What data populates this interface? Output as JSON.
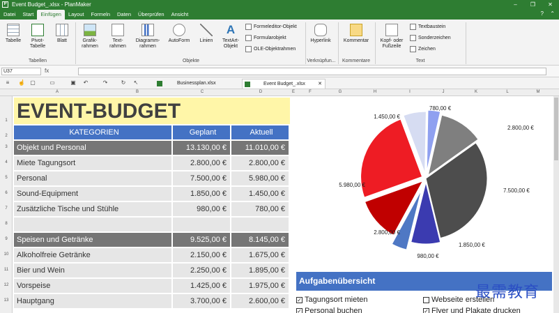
{
  "window": {
    "title": "Event Budget_.xlsx - PlanMaker",
    "app_icon": "P",
    "min": "–",
    "max": "❐",
    "close": "✕"
  },
  "menu": {
    "items": [
      "Datei",
      "Start",
      "Einfügen",
      "Layout",
      "Formeln",
      "Daten",
      "Überprüfen",
      "Ansicht"
    ],
    "active": "Einfügen",
    "help": "?",
    "collapse": "⌃"
  },
  "ribbon": {
    "tabellen": {
      "label": "Tabellen",
      "buttons": [
        "Tabelle",
        "Pivot-Tabelle",
        "Blatt"
      ]
    },
    "objekte": {
      "label": "Objekte",
      "buttons": [
        "Grafik-rahmen",
        "Text-rahmen",
        "Diagramm-rahmen",
        "AutoForm",
        "Linien",
        "TextArt-Objekt"
      ],
      "small": [
        "Formeleditor-Objekt",
        "Formularobjekt",
        "OLE-Objektrahmen"
      ]
    },
    "verknuepfungen": {
      "label": "Verknüpfun...",
      "buttons": [
        "Hyperlink"
      ]
    },
    "kommentare": {
      "label": "Kommentare",
      "buttons": [
        "Kommentar"
      ]
    },
    "text": {
      "label": "Text",
      "buttons": [
        "Kopf- oder Fußzeile"
      ],
      "small": [
        "Textbaustein",
        "Sonderzeichen",
        "Zeichen"
      ]
    }
  },
  "formula": {
    "cell": "U37",
    "fx": "fx",
    "value": ""
  },
  "tabs": {
    "items": [
      "Businessplan.xlsx",
      "Event Budget_.xlsx"
    ],
    "active": "Event Budget_.xlsx",
    "close": "✕"
  },
  "columns": [
    "A",
    "B",
    "C",
    "D",
    "E",
    "F",
    "G",
    "H",
    "I",
    "J",
    "K",
    "L",
    "M"
  ],
  "sheet": {
    "title": "EVENT-BUDGET",
    "headers": {
      "category": "KATEGORIEN",
      "planned": "Geplant",
      "actual": "Aktuell"
    },
    "rows": [
      {
        "n": "3",
        "type": "group",
        "label": "Objekt und Personal",
        "planned": "13.130,00 €",
        "actual": "11.010,00 €"
      },
      {
        "n": "4",
        "type": "item",
        "label": "Miete Tagungsort",
        "planned": "2.800,00 €",
        "actual": "2.800,00 €"
      },
      {
        "n": "5",
        "type": "item",
        "label": "Personal",
        "planned": "7.500,00 €",
        "actual": "5.980,00 €"
      },
      {
        "n": "6",
        "type": "item",
        "label": "Sound-Equipment",
        "planned": "1.850,00 €",
        "actual": "1.450,00 €"
      },
      {
        "n": "7",
        "type": "item",
        "label": "Zusätzliche Tische und Stühle",
        "planned": "980,00 €",
        "actual": "780,00 €"
      },
      {
        "n": "8",
        "type": "empty",
        "label": "",
        "planned": "",
        "actual": ""
      },
      {
        "n": "9",
        "type": "group",
        "label": "Speisen und Getränke",
        "planned": "9.525,00 €",
        "actual": "8.145,00 €"
      },
      {
        "n": "10",
        "type": "item",
        "label": "Alkoholfreie Getränke",
        "planned": "2.150,00 €",
        "actual": "1.675,00 €"
      },
      {
        "n": "11",
        "type": "item",
        "label": "Bier und Wein",
        "planned": "2.250,00 €",
        "actual": "1.895,00 €"
      },
      {
        "n": "12",
        "type": "item",
        "label": "Vorspeise",
        "planned": "1.425,00 €",
        "actual": "1.975,00 €"
      },
      {
        "n": "13",
        "type": "item",
        "label": "Hauptgang",
        "planned": "3.700,00 €",
        "actual": "2.600,00 €"
      }
    ]
  },
  "chart_data": {
    "type": "pie",
    "slices": [
      {
        "label": "780,00 €",
        "value": 780,
        "color": "#8fa0f0"
      },
      {
        "label": "2.800,00 €",
        "value": 2800,
        "color": "#7f7f7f"
      },
      {
        "label": "7.500,00 €",
        "value": 7500,
        "color": "#4d4d4d"
      },
      {
        "label": "1.850,00 €",
        "value": 1850,
        "color": "#3b3bb0"
      },
      {
        "label": "980,00 €",
        "value": 980,
        "color": "#4f78c4"
      },
      {
        "label": "2.800,00 €",
        "value": 2800,
        "color": "#c00000"
      },
      {
        "label": "5.980,00 €",
        "value": 5980,
        "color": "#ee1c24"
      },
      {
        "label": "1.450,00 €",
        "value": 1450,
        "color": "#d6dcf2"
      }
    ]
  },
  "tasks": {
    "title": "Aufgabenübersicht",
    "items": [
      {
        "label": "Tagungsort mieten",
        "checked": true
      },
      {
        "label": "Webseite erstellen",
        "checked": false
      },
      {
        "label": "Personal buchen",
        "checked": true
      },
      {
        "label": "Flyer und Plakate drucken",
        "checked": false
      }
    ],
    "check": "✓"
  },
  "watermark": "最需教育"
}
